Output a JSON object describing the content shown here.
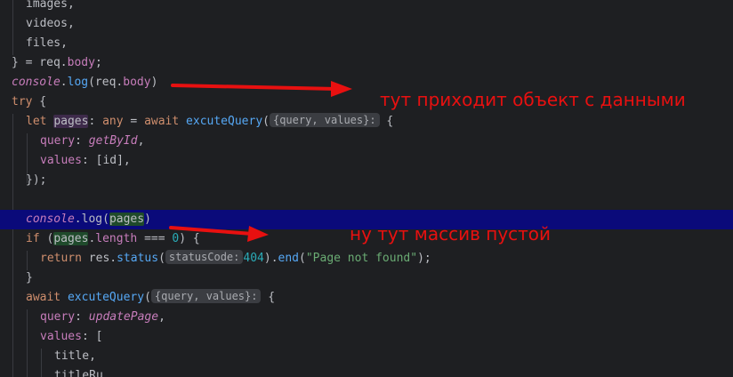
{
  "code": {
    "l1": "images,",
    "l2": "videos,",
    "l3": "files,",
    "l4_a": "} = req.",
    "l4_b": "body",
    "l4_c": ";",
    "l5_a": "console",
    "l5_b": ".",
    "l5_c": "log",
    "l5_d": "(req.",
    "l5_e": "body",
    "l5_f": ")",
    "l6_a": "try",
    "l6_b": " {",
    "l7_a": "let ",
    "l7_b": "pages",
    "l7_c": ": ",
    "l7_d": "any",
    "l7_e": " = ",
    "l7_f": "await ",
    "l7_g": "excuteQuery",
    "l7_h": "(",
    "l7_hint": "{query, values}:",
    "l7_i": " {",
    "l8_a": "query",
    "l8_b": ": ",
    "l8_c": "getById",
    "l8_d": ",",
    "l9_a": "values",
    "l9_b": ": [id],",
    "l10": "});",
    "l12_a": "console",
    "l12_b": ".log(",
    "l12_c": "pages",
    "l12_d": ")",
    "l13_a": "if",
    "l13_b": " (",
    "l13_c": "pages",
    "l13_d": ".",
    "l13_e": "length",
    "l13_f": " === ",
    "l13_g": "0",
    "l13_h": ") {",
    "l14_a": "return ",
    "l14_b": "res.",
    "l14_c": "status",
    "l14_d": "(",
    "l14_hint": "statusCode:",
    "l14_e": "404",
    "l14_f": ").",
    "l14_g": "end",
    "l14_h": "(",
    "l14_i": "\"Page not found\"",
    "l14_j": ");",
    "l15": "}",
    "l16_a": "await ",
    "l16_b": "excuteQuery",
    "l16_c": "(",
    "l16_hint": "{query, values}:",
    "l16_d": " {",
    "l17_a": "query",
    "l17_b": ": ",
    "l17_c": "updatePage",
    "l17_d": ",",
    "l18_a": "values",
    "l18_b": ": [",
    "l19": "title,",
    "l20": "titleRu,"
  },
  "annotations": {
    "first": "тут приходит объект с данными",
    "second": "ну тут массив пустой"
  },
  "colors": {
    "background": "#1e1f22",
    "highlight_line": "#0a0a7a",
    "annotation": "#e81010"
  }
}
